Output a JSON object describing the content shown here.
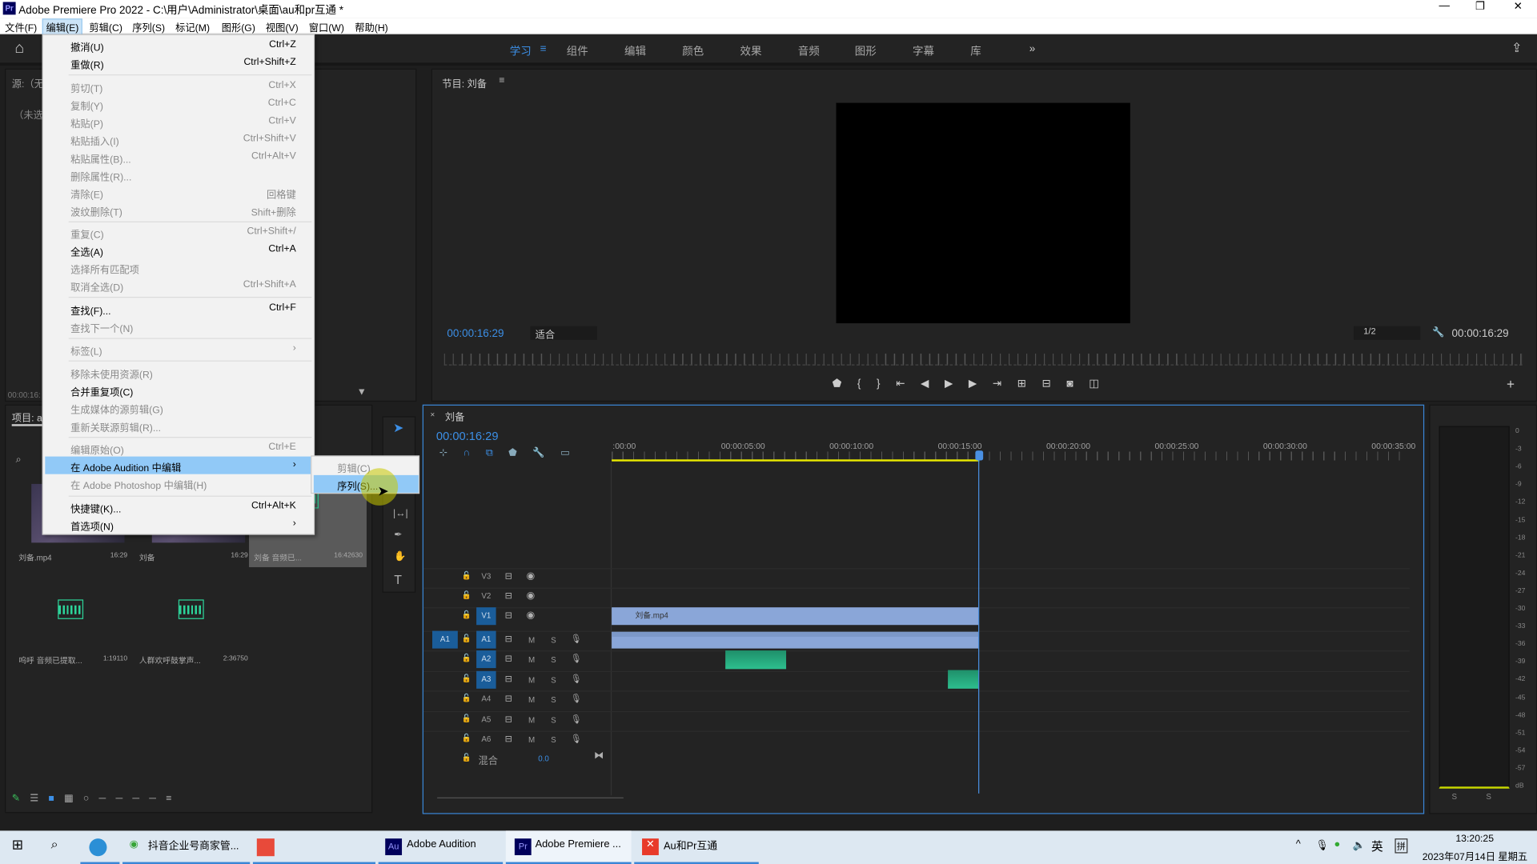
{
  "window": {
    "title": "Adobe Premiere Pro 2022 - C:\\用户\\Administrator\\桌面\\au和pr互通 *",
    "app_icon": "Pr"
  },
  "menubar": [
    "文件(F)",
    "编辑(E)",
    "剪辑(C)",
    "序列(S)",
    "标记(M)",
    "图形(G)",
    "视图(V)",
    "窗口(W)",
    "帮助(H)"
  ],
  "workspaces": [
    "学习",
    "组件",
    "编辑",
    "颜色",
    "效果",
    "音频",
    "图形",
    "字幕",
    "库"
  ],
  "workspace_more": "»",
  "edit_menu": [
    {
      "label": "撤消(U)",
      "shortcut": "Ctrl+Z",
      "enabled": true
    },
    {
      "label": "重做(R)",
      "shortcut": "Ctrl+Shift+Z",
      "enabled": true
    },
    {
      "label": "剪切(T)",
      "shortcut": "Ctrl+X",
      "enabled": false
    },
    {
      "label": "复制(Y)",
      "shortcut": "Ctrl+C",
      "enabled": false
    },
    {
      "label": "粘贴(P)",
      "shortcut": "Ctrl+V",
      "enabled": false
    },
    {
      "label": "粘贴插入(I)",
      "shortcut": "Ctrl+Shift+V",
      "enabled": false
    },
    {
      "label": "粘贴属性(B)...",
      "shortcut": "Ctrl+Alt+V",
      "enabled": false
    },
    {
      "label": "删除属性(R)...",
      "shortcut": "",
      "enabled": false
    },
    {
      "label": "清除(E)",
      "shortcut": "回格键",
      "enabled": false
    },
    {
      "label": "波纹删除(T)",
      "shortcut": "Shift+删除",
      "enabled": false
    },
    {
      "label": "重复(C)",
      "shortcut": "Ctrl+Shift+/",
      "enabled": false
    },
    {
      "label": "全选(A)",
      "shortcut": "Ctrl+A",
      "enabled": true
    },
    {
      "label": "选择所有匹配项",
      "shortcut": "",
      "enabled": false
    },
    {
      "label": "取消全选(D)",
      "shortcut": "Ctrl+Shift+A",
      "enabled": false
    },
    {
      "label": "查找(F)...",
      "shortcut": "Ctrl+F",
      "enabled": true
    },
    {
      "label": "查找下一个(N)",
      "shortcut": "",
      "enabled": false
    },
    {
      "label": "标签(L)",
      "shortcut": "›",
      "enabled": false
    },
    {
      "label": "移除未使用资源(R)",
      "shortcut": "",
      "enabled": false
    },
    {
      "label": "合并重复项(C)",
      "shortcut": "",
      "enabled": true
    },
    {
      "label": "生成媒体的源剪辑(G)",
      "shortcut": "",
      "enabled": false
    },
    {
      "label": "重新关联源剪辑(R)...",
      "shortcut": "",
      "enabled": false
    },
    {
      "label": "编辑原始(O)",
      "shortcut": "Ctrl+E",
      "enabled": false
    },
    {
      "label": "在 Adobe Audition 中编辑",
      "shortcut": "›",
      "enabled": true,
      "highlighted": true
    },
    {
      "label": "在 Adobe Photoshop 中编辑(H)",
      "shortcut": "",
      "enabled": false
    },
    {
      "label": "快捷键(K)...",
      "shortcut": "Ctrl+Alt+K",
      "enabled": true
    },
    {
      "label": "首选项(N)",
      "shortcut": "›",
      "enabled": true
    }
  ],
  "submenu": [
    {
      "label": "剪辑(C)",
      "enabled": false
    },
    {
      "label": "序列(S)...",
      "enabled": true,
      "highlighted": true
    }
  ],
  "source": {
    "title": "源:（无",
    "empty": "（未选",
    "timecode": "00:00:16:"
  },
  "project": {
    "title": "项目: a",
    "folder": "a",
    "items": [
      {
        "name": "刘备.mp4",
        "duration": "16:29"
      },
      {
        "name": "刘备",
        "duration": "16:29"
      },
      {
        "name": "刘备 音频已...",
        "duration": "16:42630"
      },
      {
        "name": "呜呼 音频已提取...",
        "duration": "1:19110"
      },
      {
        "name": "人群欢呼鼓掌声...",
        "duration": "2:36750"
      }
    ]
  },
  "program": {
    "title": "节目: 刘备",
    "timecode": "00:00:16:29",
    "fit": "适合",
    "resolution": "1/2",
    "duration": "00:00:16:29"
  },
  "timeline": {
    "title": "刘备",
    "timecode": "00:00:16:29",
    "ruler": [
      ":00:00",
      "00:00:05:00",
      "00:00:10:00",
      "00:00:15:00",
      "00:00:20:00",
      "00:00:25:00",
      "00:00:30:00",
      "00:00:35:00"
    ],
    "video_tracks": [
      "V3",
      "V2",
      "V1"
    ],
    "audio_tracks": [
      "A1",
      "A2",
      "A3",
      "A4",
      "A5",
      "A6"
    ],
    "source_patch": "A1",
    "mix_label": "混合",
    "mix_value": "0.0",
    "clip_v1": "刘备.mp4",
    "m": "M",
    "s": "S"
  },
  "meter": {
    "scale": [
      "0",
      "-3",
      "-6",
      "-9",
      "-12",
      "-15",
      "-18",
      "-21",
      "-24",
      "-27",
      "-30",
      "-33",
      "-36",
      "-39",
      "-42",
      "-45",
      "-48",
      "-51",
      "-54",
      "-57",
      "dB"
    ],
    "solo": [
      "S",
      "S"
    ]
  },
  "taskbar": {
    "apps": [
      "抖音企业号商家管...",
      "Adobe Audition",
      "Adobe Premiere ...",
      "Au和Pr互通"
    ],
    "ime1": "英",
    "ime2": "拼",
    "time": "13:20:25",
    "date": "2023年07月14日 星期五"
  },
  "colors": {
    "accent": "#2d8ceb",
    "menu_highlight": "#91c9f7",
    "video_clip": "#8aa6d8",
    "audio_clip": "#2dbf8e",
    "playhead": "#4a90e2",
    "work_area": "#e8e800"
  }
}
